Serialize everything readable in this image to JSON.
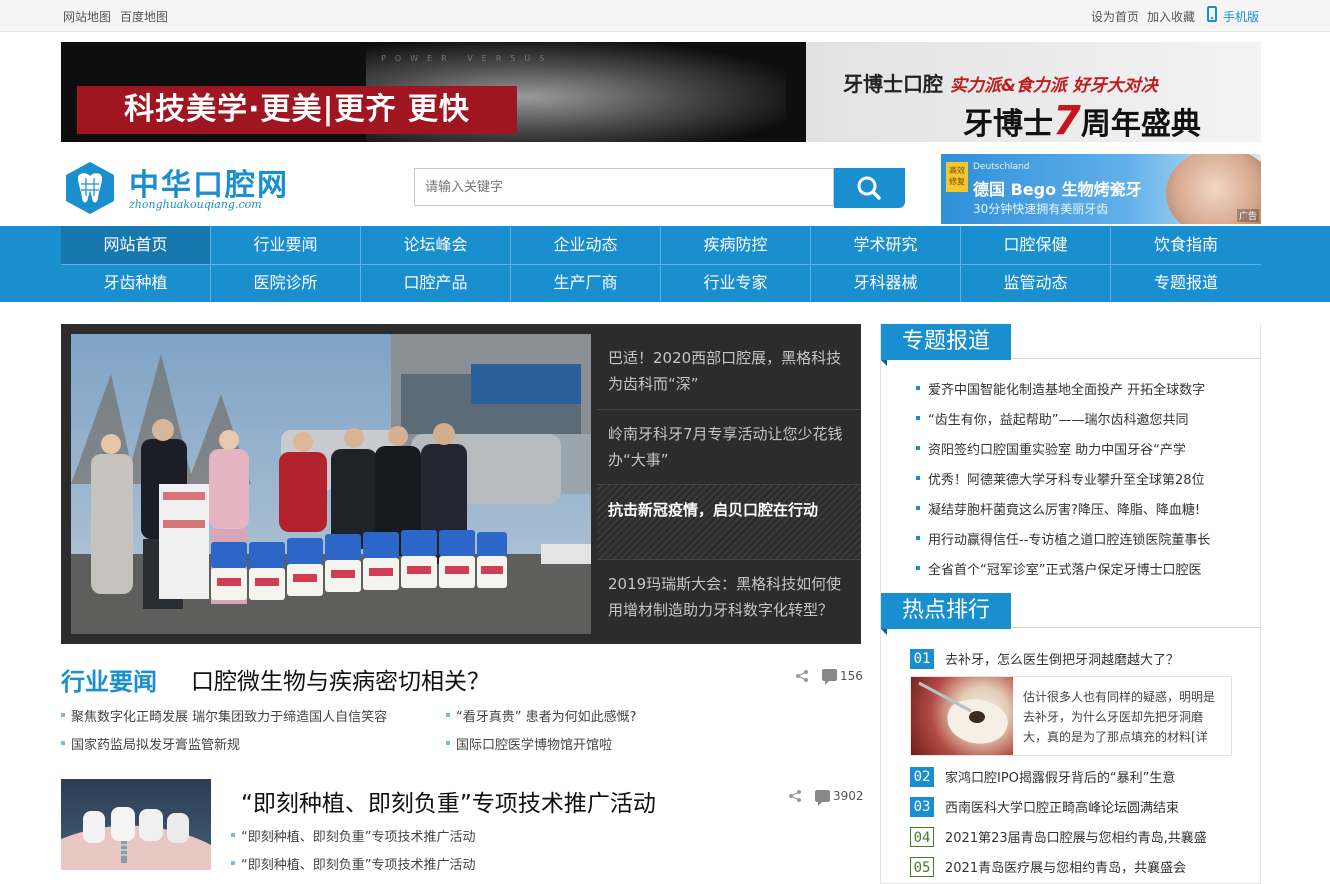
{
  "topbar": {
    "left_links": [
      "网站地图",
      "百度地图"
    ],
    "right_links": [
      "设为首页",
      "加入收藏"
    ],
    "mobile": "手机版"
  },
  "banner": {
    "slogan": "科技美学·更美|更齐 更快",
    "power_text": "POWER VERSUS",
    "brand": "牙博士口腔",
    "brand_slogan": "实力派&食力派 好牙大对决",
    "anniv_prefix": "牙博士",
    "anniv_number": "7",
    "anniv_suffix": "周年盛典"
  },
  "header": {
    "logo_title": "中华口腔网",
    "logo_sub": "zhonghuakouqiang.com",
    "search_placeholder": "请输入关键字",
    "ad": {
      "tag": "高效 修复",
      "de": "Deutschland",
      "title": "德国 Bego 生物烤瓷牙",
      "subtitle": "30分钟快速拥有美丽牙齿",
      "mark": "广告"
    }
  },
  "nav": {
    "row1": [
      "网站首页",
      "行业要闻",
      "论坛峰会",
      "企业动态",
      "疾病防控",
      "学术研究",
      "口腔保健",
      "饮食指南"
    ],
    "row2": [
      "牙齿种植",
      "医院诊所",
      "口腔产品",
      "生产厂商",
      "行业专家",
      "牙科器械",
      "监管动态",
      "专题报道"
    ]
  },
  "slider": {
    "items": [
      "巴适！2020西部口腔展，黑格科技为齿科而“深”",
      "岭南牙科牙7月专享活动让您少花钱办“大事”",
      "抗击新冠疫情，启贝口腔在行动",
      "2019玛瑞斯大会：黑格科技如何使用增材制造助力牙科数字化转型？"
    ],
    "active_index": 2
  },
  "news": {
    "section_label": "行业要闻",
    "headline": "口腔微生物与疾病密切相关？",
    "comments": "156",
    "links": [
      "聚焦数字化正畸发展 瑞尔集团致力于缔造国人自信笑容",
      "“看牙真贵” 患者为何如此感慨?",
      "国家药监局拟发牙膏监管新规",
      "国际口腔医学博物馆开馆啦"
    ]
  },
  "news2": {
    "headline": "“即刻种植、即刻负重”专项技术推广活动",
    "comments": "3902",
    "links": [
      "“即刻种植、即刻负重”专项技术推广活动",
      "“即刻种植、即刻负重”专项技术推广活动"
    ]
  },
  "sidebar": {
    "special_title": "专题报道",
    "special_items": [
      "爱齐中国智能化制造基地全面投产 开拓全球数字",
      "“齿生有你，益起帮助”——瑞尔齿科邀您共同",
      "资阳签约口腔国重实验室 助力中国牙谷“产学",
      "优秀！阿德莱德大学牙科专业攀升至全球第28位",
      "凝结芽胞杆菌竟这么厉害?降压、降脂、降血糖!",
      "用行动赢得信任--专访植之道口腔连锁医院董事长",
      "全省首个“冠军诊室”正式落户保定牙博士口腔医"
    ],
    "hot_title": "热点排行",
    "hot_items": [
      {
        "num": "01",
        "text": "去补牙，怎么医生倒把牙洞越磨越大了？"
      },
      {
        "num": "02",
        "text": "家鸿口腔IPO揭露假牙背后的“暴利”生意"
      },
      {
        "num": "03",
        "text": "西南医科大学口腔正畸高峰论坛圆满结束"
      },
      {
        "num": "04",
        "text": "2021第23届青岛口腔展与您相约青岛,共襄盛"
      },
      {
        "num": "05",
        "text": "2021青岛医疗展与您相约青岛，共襄盛会"
      }
    ],
    "hot_detail": "估计很多人也有同样的疑惑，明明是去补牙，为什么牙医却先把牙洞磨大，真的是为了那点填充的材料[详细]"
  },
  "colors": {
    "accent": "#1a8fcf",
    "nav_active": "#1778b0",
    "slider_bg": "#2c2c2c"
  }
}
